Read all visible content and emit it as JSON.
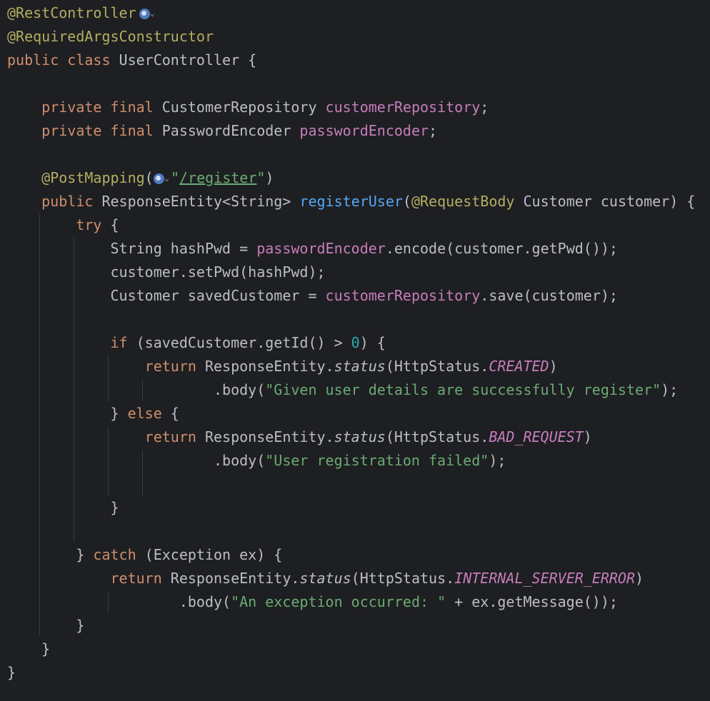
{
  "icons": {
    "endpoint": "globe-icon",
    "dropdown": "chevron-down-icon"
  },
  "colors": {
    "background": "#1e1f22",
    "text": "#bcbec4",
    "annotation": "#b3ae60",
    "keyword": "#cf8e6d",
    "field": "#c77dbb",
    "method": "#56a8f5",
    "string": "#6aab73",
    "number": "#2aacb8"
  },
  "code": {
    "l1": {
      "ann": "@RestController",
      "caret": "⌄"
    },
    "l2": {
      "ann": "@RequiredArgsConstructor"
    },
    "l3": {
      "kw": "public class",
      "rest": " UserController {"
    },
    "l5": {
      "kw": "private final",
      "type": " CustomerRepository ",
      "fld": "customerRepository",
      "end": ";"
    },
    "l6": {
      "kw": "private final",
      "type": " PasswordEncoder ",
      "fld": "passwordEncoder",
      "end": ";"
    },
    "l8": {
      "ann": "@PostMapping",
      "paren": "(",
      "caret": "⌄",
      "q1": "\"",
      "path": "/register",
      "q2": "\"",
      "close": ")"
    },
    "l9": {
      "kw": "public",
      "type": " ResponseEntity<String> ",
      "fn": "registerUser",
      "open": "(",
      "ann": "@RequestBody",
      "rest": " Customer customer) {"
    },
    "l10": {
      "kw": "try",
      "rest": " {"
    },
    "l11": {
      "a": "String hashPwd = ",
      "fld": "passwordEncoder",
      "b": ".encode(customer.getPwd());"
    },
    "l12": {
      "text": "customer.setPwd(hashPwd);"
    },
    "l13": {
      "a": "Customer savedCustomer = ",
      "fld": "customerRepository",
      "b": ".save(customer);"
    },
    "l15": {
      "kw": "if",
      "a": " (savedCustomer.getId() > ",
      "num": "0",
      "b": ") {"
    },
    "l16": {
      "kw": "return",
      "a": " ResponseEntity.",
      "m": "status",
      "b": "(HttpStatus.",
      "c": "CREATED",
      "d": ")"
    },
    "l17": {
      "a": ".body(",
      "str": "\"Given user details are successfully register\"",
      "b": ");"
    },
    "l18": {
      "a": "} ",
      "kw": "else",
      "b": " {"
    },
    "l19": {
      "kw": "return",
      "a": " ResponseEntity.",
      "m": "status",
      "b": "(HttpStatus.",
      "c": "BAD_REQUEST",
      "d": ")"
    },
    "l20": {
      "a": ".body(",
      "str": "\"User registration failed\"",
      "b": ");"
    },
    "l22": {
      "text": "}"
    },
    "l24": {
      "a": "} ",
      "kw": "catch",
      "b": " (Exception ex) {"
    },
    "l25": {
      "kw": "return",
      "a": " ResponseEntity.",
      "m": "status",
      "b": "(HttpStatus.",
      "c": "INTERNAL_SERVER_ERROR",
      "d": ")"
    },
    "l26": {
      "a": ".body(",
      "str": "\"An exception occurred: \"",
      "b": " + ex.getMessage());"
    },
    "l27": {
      "text": "}"
    },
    "l28": {
      "text": "}"
    },
    "l29": {
      "text": "}"
    }
  }
}
